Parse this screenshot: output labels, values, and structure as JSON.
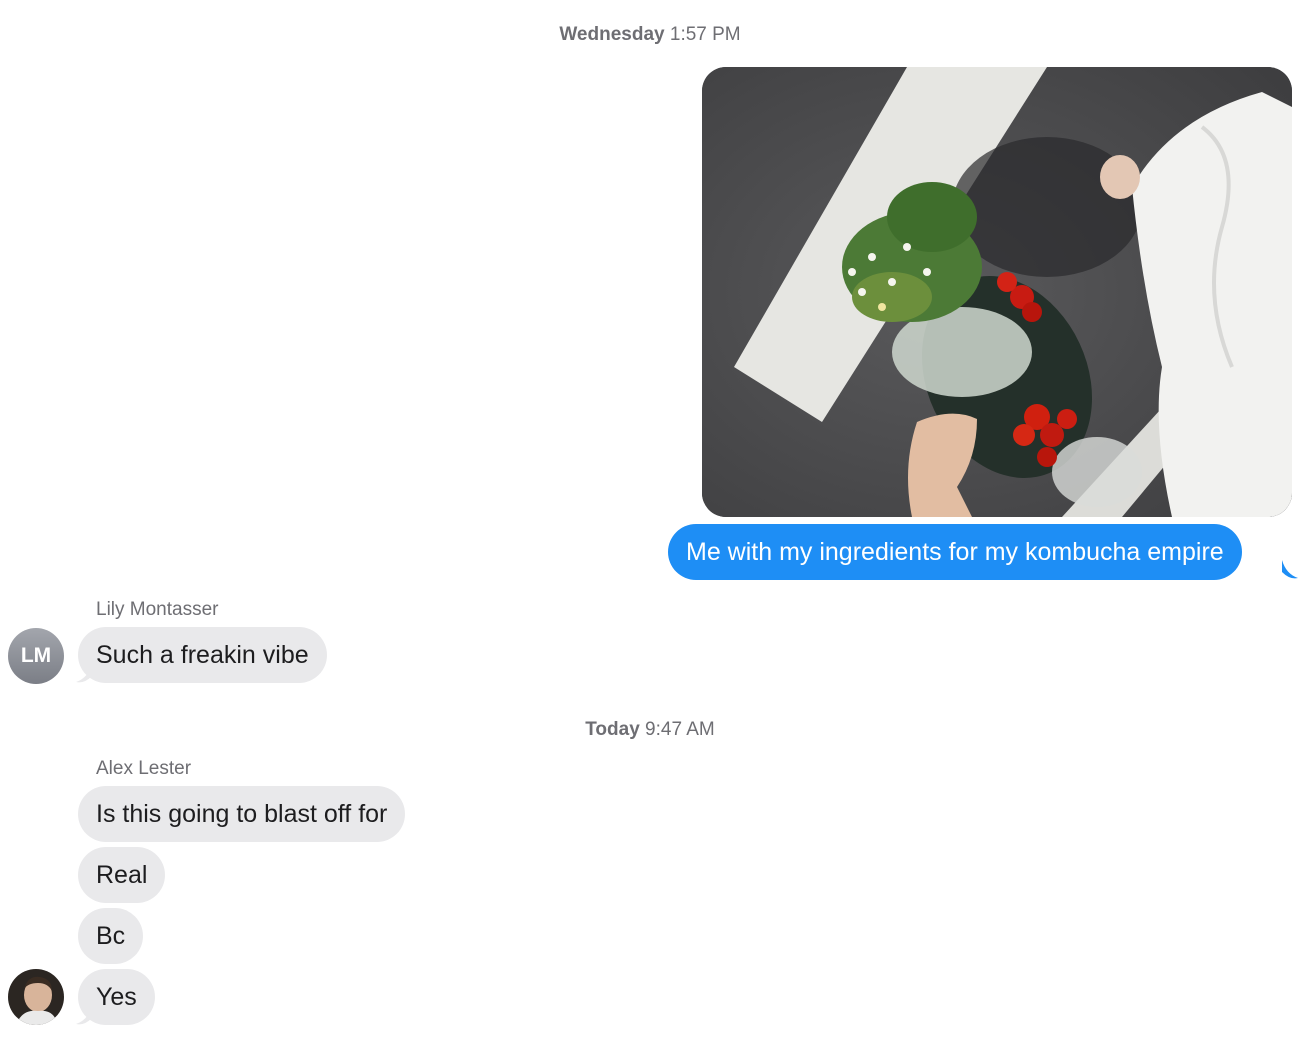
{
  "conversation": {
    "timestamp_1": {
      "day": "Wednesday",
      "time": "1:57 PM"
    },
    "timestamp_2": {
      "day": "Today",
      "time": "9:47 AM"
    },
    "outgoing": {
      "caption": "Me with my ingredients for my kombucha empire",
      "bubble_color": "#1e8ef5"
    },
    "lily": {
      "name": "Lily Montasser",
      "initials": "LM",
      "message": "Such a freakin vibe"
    },
    "alex": {
      "name": "Alex Lester",
      "messages": [
        "Is this going to blast off for",
        "Real",
        "Bc",
        "Yes"
      ]
    },
    "incoming_bubble_color": "#e9e9eb"
  },
  "icons": {
    "photo": "photo-attachment",
    "avatar_alex": "person-avatar-photo"
  }
}
